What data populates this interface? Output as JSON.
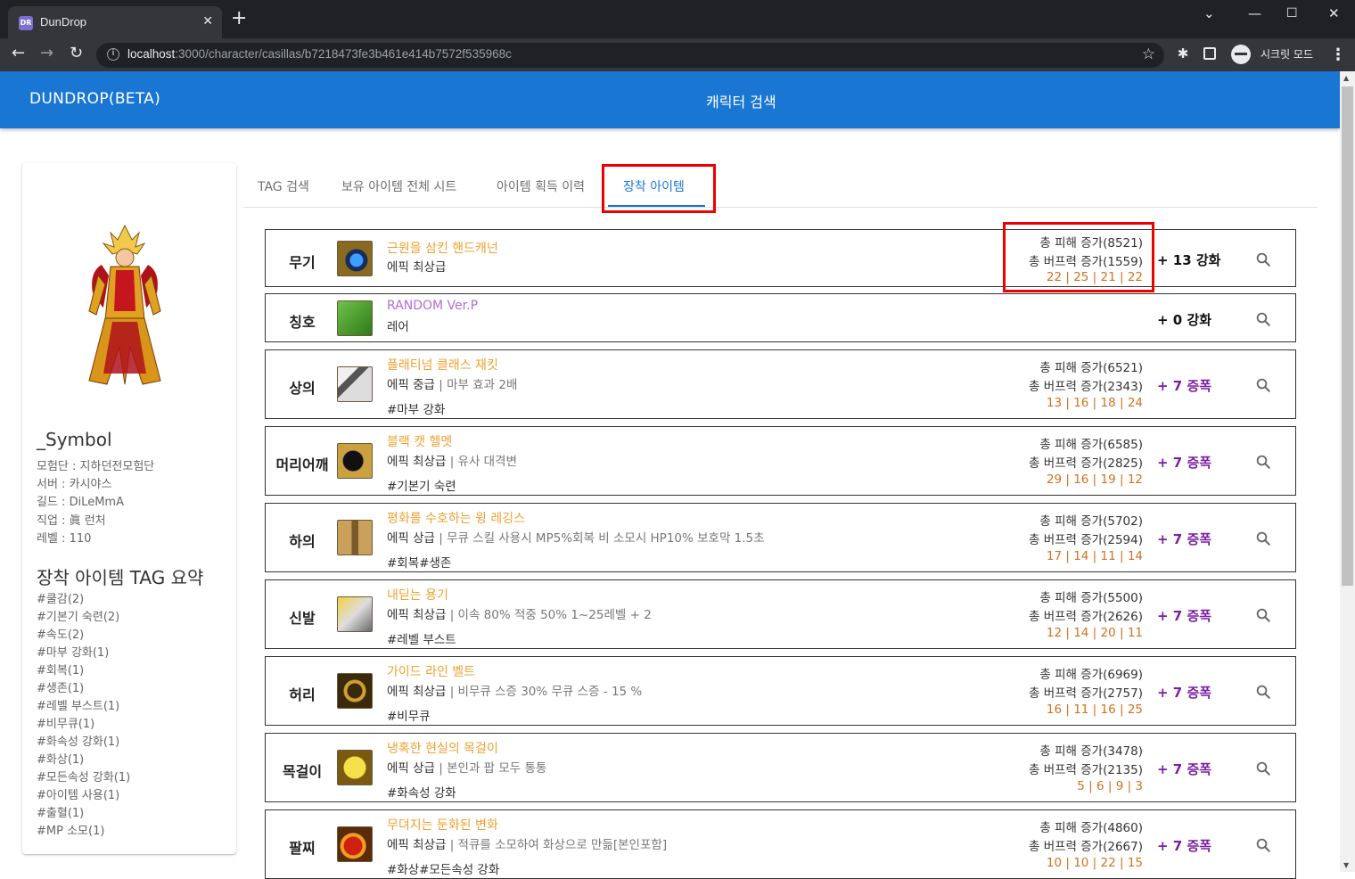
{
  "browser": {
    "tab_title": "DunDrop",
    "tab_favicon": "DR",
    "url_host": "localhost",
    "url_rest": ":3000/character/casillas/b7218473fe3b461e414b7572f535968c",
    "profile_label": "시크릿 모드"
  },
  "appbar": {
    "brand": "DUNDROP(BETA)",
    "title": "캐릭터 검색",
    "color": "#1976d2"
  },
  "character": {
    "name": "_Symbol",
    "info": [
      "모험단 : 지하던전모험단",
      "서버 : 카시야스",
      "길드 : DiLeMmA",
      "직업 : 眞 런처",
      "레벨 : 110"
    ],
    "tag_summary_title": "장착 아이템 TAG 요약",
    "tags": [
      "#쿨감(2)",
      "#기본기 숙련(2)",
      "#속도(2)",
      "#마부 강화(1)",
      "#회복(1)",
      "#생존(1)",
      "#레벨 부스트(1)",
      "#비무큐(1)",
      "#화속성 강화(1)",
      "#화상(1)",
      "#모든속성 강화(1)",
      "#아이템 사용(1)",
      "#출혈(1)",
      "#MP 소모(1)"
    ]
  },
  "tabs": [
    "TAG 검색",
    "보유 아이템 전체 시트",
    "아이템 획득 이력",
    "장착 아이템"
  ],
  "active_tab": "장착 아이템",
  "equipment": [
    {
      "slot": "무기",
      "name": "근원을 삼킨 핸드캐넌",
      "rarity": "epic",
      "grade": "에픽 최상급",
      "desc": "",
      "tag": "",
      "stat1": "총 피해 증가(8521)",
      "stat2": "총 버프력 증가(1559)",
      "nums": "22 |  25 |  21 |  22",
      "enhance": "+ 13 강화",
      "enhance_type": "reinforce",
      "icon": "handcannon-icon"
    },
    {
      "slot": "칭호",
      "name": "RANDOM Ver.P",
      "rarity": "rare",
      "grade": "레어",
      "desc": "",
      "tag": "",
      "stat1": "",
      "stat2": "",
      "nums": "",
      "enhance": "+ 0 강화",
      "enhance_type": "reinforce",
      "icon": "title-icon"
    },
    {
      "slot": "상의",
      "name": "플래티넘 클래스 재킷",
      "rarity": "epic",
      "grade": "에픽 중급",
      "desc": " | 마부 효과 2배",
      "tag": "#마부 강화",
      "stat1": "총 피해 증가(6521)",
      "stat2": "총 버프력 증가(2343)",
      "nums": "13 |  16 |  18 |  24",
      "enhance": "+ 7 증폭",
      "enhance_type": "amplify",
      "icon": "jacket-icon"
    },
    {
      "slot": "머리어깨",
      "name": "블랙 캣 헬멧",
      "rarity": "epic",
      "grade": "에픽 최상급",
      "desc": " | 유사 대격변",
      "tag": "#기본기 숙련",
      "stat1": "총 피해 증가(6585)",
      "stat2": "총 버프력 증가(2825)",
      "nums": "29 |  16 |  19 |  12",
      "enhance": "+ 7 증폭",
      "enhance_type": "amplify",
      "icon": "helmet-icon"
    },
    {
      "slot": "하의",
      "name": "평화를 수호하는 윙 레깅스",
      "rarity": "epic",
      "grade": "에픽 상급",
      "desc": " | 무큐 스킬 사용시 MP5%회복 비 소모시 HP10% 보호막 1.5초",
      "tag": "#회복#생존",
      "stat1": "총 피해 증가(5702)",
      "stat2": "총 버프력 증가(2594)",
      "nums": "17 |  14 |  11 |  14",
      "enhance": "+ 7 증폭",
      "enhance_type": "amplify",
      "icon": "leggings-icon"
    },
    {
      "slot": "신발",
      "name": "내딛는 용기",
      "rarity": "epic",
      "grade": "에픽 최상급",
      "desc": " | 이속 80% 적중 50% 1~25레벨 + 2",
      "tag": "#레벨 부스트",
      "stat1": "총 피해 증가(5500)",
      "stat2": "총 버프력 증가(2626)",
      "nums": "12 |  14 |  20 |  11",
      "enhance": "+ 7 증폭",
      "enhance_type": "amplify",
      "icon": "shoes-icon"
    },
    {
      "slot": "허리",
      "name": "가이드 라인 벨트",
      "rarity": "epic",
      "grade": "에픽 최상급",
      "desc": " | 비무큐 스증 30% 무큐 스증 - 15 %",
      "tag": "#비무큐",
      "stat1": "총 피해 증가(6969)",
      "stat2": "총 버프력 증가(2757)",
      "nums": "16 |  11 |  16 |  25",
      "enhance": "+ 7 증폭",
      "enhance_type": "amplify",
      "icon": "belt-icon"
    },
    {
      "slot": "목걸이",
      "name": "냉혹한 현실의 목걸이",
      "rarity": "epic",
      "grade": "에픽 상급",
      "desc": " | 본인과 팝 모두 통통",
      "tag": "#화속성 강화",
      "stat1": "총 피해 증가(3478)",
      "stat2": "총 버프력 증가(2135)",
      "nums": "5 |  6 |  9 |  3",
      "enhance": "+ 7 증폭",
      "enhance_type": "amplify",
      "icon": "necklace-icon"
    },
    {
      "slot": "팔찌",
      "name": "무뎌지는 둔화된 변화",
      "rarity": "epic",
      "grade": "에픽 최상급",
      "desc": " | 적큐를 소모하여 화상으로 만듦[본인포함]",
      "tag": "#화상#모든속성 강화",
      "stat1": "총 피해 증가(4860)",
      "stat2": "총 버프력 증가(2667)",
      "nums": "10 |  10 |  22 |  15",
      "enhance": "+ 7 증폭",
      "enhance_type": "amplify",
      "icon": "bracelet-icon"
    }
  ]
}
